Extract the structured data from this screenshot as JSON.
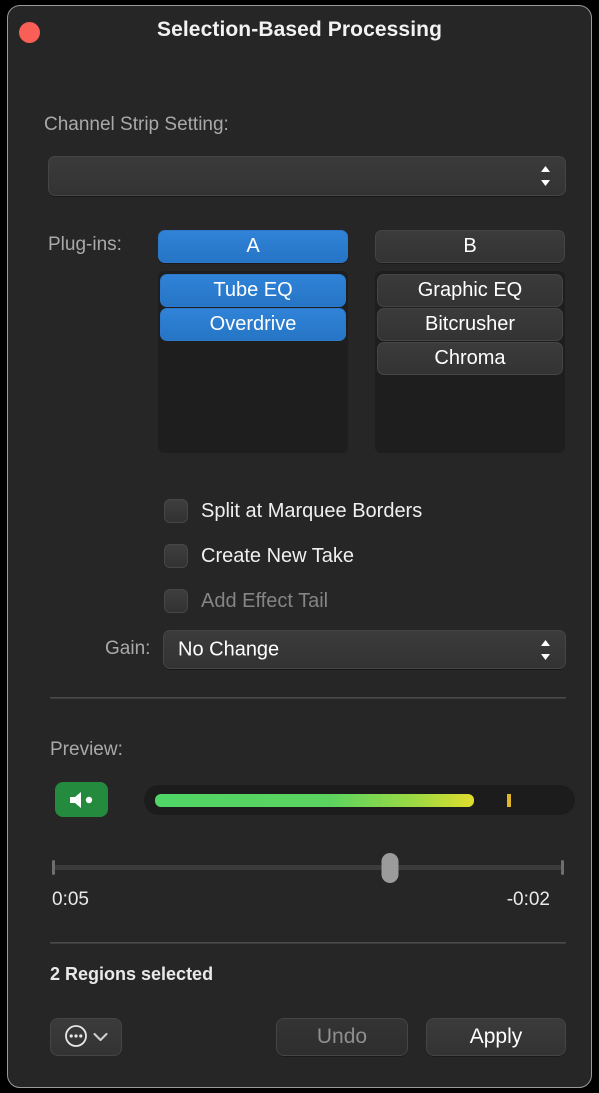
{
  "window": {
    "title": "Selection-Based Processing",
    "close_icon": "close-button-red"
  },
  "channel_strip": {
    "label": "Channel Strip Setting:",
    "value": "",
    "placeholder": "",
    "stepper_icon": "chevron-up-down-icon"
  },
  "plugins": {
    "label": "Plug-ins:",
    "slot_a": {
      "button_label": "A",
      "selected": true,
      "items": [
        {
          "label": "Tube EQ",
          "selected": true
        },
        {
          "label": "Overdrive",
          "selected": true
        }
      ]
    },
    "slot_b": {
      "button_label": "B",
      "selected": false,
      "items": [
        {
          "label": "Graphic EQ",
          "selected": false
        },
        {
          "label": "Bitcrusher",
          "selected": false
        },
        {
          "label": "Chroma",
          "selected": false
        }
      ]
    }
  },
  "options": [
    {
      "label": "Split at Marquee Borders",
      "checked": false,
      "enabled": true
    },
    {
      "label": "Create New Take",
      "checked": false,
      "enabled": true
    },
    {
      "label": "Add Effect Tail",
      "checked": false,
      "enabled": false
    }
  ],
  "gain": {
    "label": "Gain:",
    "value": "No Change",
    "stepper_icon": "chevron-up-down-icon",
    "options": [
      "No Change"
    ]
  },
  "preview": {
    "label": "Preview:",
    "speaker_icon": "speaker-wave-icon",
    "speaker_color": "#248a3d",
    "meter": {
      "level_percent": 78,
      "peak_percent": 86,
      "gradient_start": "#4fd666",
      "gradient_end": "#e1dd2e",
      "peak_color": "#e0b52a"
    },
    "playhead_percent": 66,
    "time_elapsed": "0:05",
    "time_remaining": "-0:02"
  },
  "footer": {
    "status": "2 Regions selected",
    "action_menu": {
      "icon": "ellipsis-circle-icon",
      "chevron_icon": "chevron-down-icon"
    },
    "undo_label": "Undo",
    "undo_enabled": false,
    "apply_label": "Apply",
    "apply_enabled": true
  }
}
